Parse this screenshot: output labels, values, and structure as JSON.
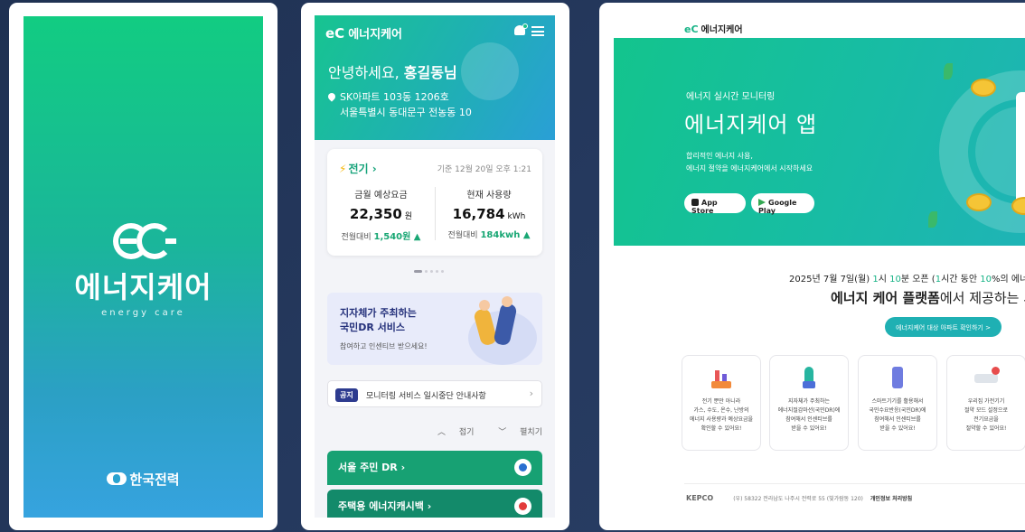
{
  "splash": {
    "brand_name": "에너지케어",
    "brand_sub": "energy care",
    "footer": "한국전력"
  },
  "mobile": {
    "app_name": "에너지케어",
    "greeting_prefix": "안녕하세요, ",
    "greeting_name": "홍길동님",
    "address_line1": "SK아파트 103동 1206호",
    "address_line2": "서울특별시 동대문구 전농동 10",
    "usage_card": {
      "category": "전기",
      "timestamp": "기준 12월 20일 오후 1:21",
      "left_title": "금월 예상요금",
      "left_value": "22,350",
      "left_unit": "원",
      "left_delta_label": "전월대비",
      "left_delta": "1,540원 ▲",
      "right_title": "현재 사용량",
      "right_value": "16,784",
      "right_unit": "kWh",
      "right_delta_label": "전월대비",
      "right_delta": "184kwh ▲"
    },
    "banner": {
      "title_line1": "지자체가 주최하는",
      "title_line2": "국민DR 서비스",
      "subtitle": "참여하고 인센티브 받으세요!"
    },
    "notice": {
      "tag": "공지",
      "text": "모니터링 서비스 일시중단 안내사항"
    },
    "fold_label": "접기",
    "unfold_label": "펼치기",
    "menu_items": [
      {
        "label": "서울 주민 DR"
      },
      {
        "label": "주택용 에너지캐시백"
      }
    ]
  },
  "web": {
    "brand": "에너지케어",
    "hero": {
      "kicker": "에너지 실시간 모니터링",
      "title": "에너지케어 앱",
      "desc_line1": "합리적인 에너지 사용,",
      "desc_line2": "에너지 절약을 에너지케어에서 시작하세요",
      "app_store": "App Store",
      "google_play": "Google Play"
    },
    "announce_prefix": "2025년 7월 7일(월) ",
    "announce_hl1": "1",
    "announce_mid1": "시 ",
    "announce_hl2": "10",
    "announce_mid2": "분 오픈 (",
    "announce_hl3": "1",
    "announce_mid3": "시간 동안 ",
    "announce_hl4": "10",
    "announce_suffix": "%의 에너지 절약으로 전원",
    "platform_title_bold": "에너지 케어 플랫폼",
    "platform_title_rest": "에서 제공하는 서",
    "check_button": "에너지케어 대상 아파트 확인하기 >",
    "features": [
      {
        "line1": "전기 뿐만 아니라",
        "line2": "가스, 수도, 온수, 난방의",
        "line3": "에너지 사용량과 예상요금을",
        "line4": "확인할 수 있어요!"
      },
      {
        "line1": "지자체가 주최하는",
        "line2": "에너지절감마션(국민DR)에",
        "line3": "참여해서 인센티브를",
        "line4": "받을 수 있어요!"
      },
      {
        "line1": "스마트기기를 활용해서",
        "line2": "국민수요반응(국민DR)에",
        "line3": "참여해서 인센티브를",
        "line4": "받을 수 있어요!"
      },
      {
        "line1": "우리집 가전기기",
        "line2": "절약 모드 설정으로",
        "line3": "전기요금을",
        "line4": "절약할 수 있어요!"
      }
    ],
    "footer_logo": "KEPCO",
    "footer_addr": "(우) 58322 전라남도 나주시 전력로 55 (빛가람동 120)",
    "footer_privacy": "개인정보 처리방침"
  }
}
